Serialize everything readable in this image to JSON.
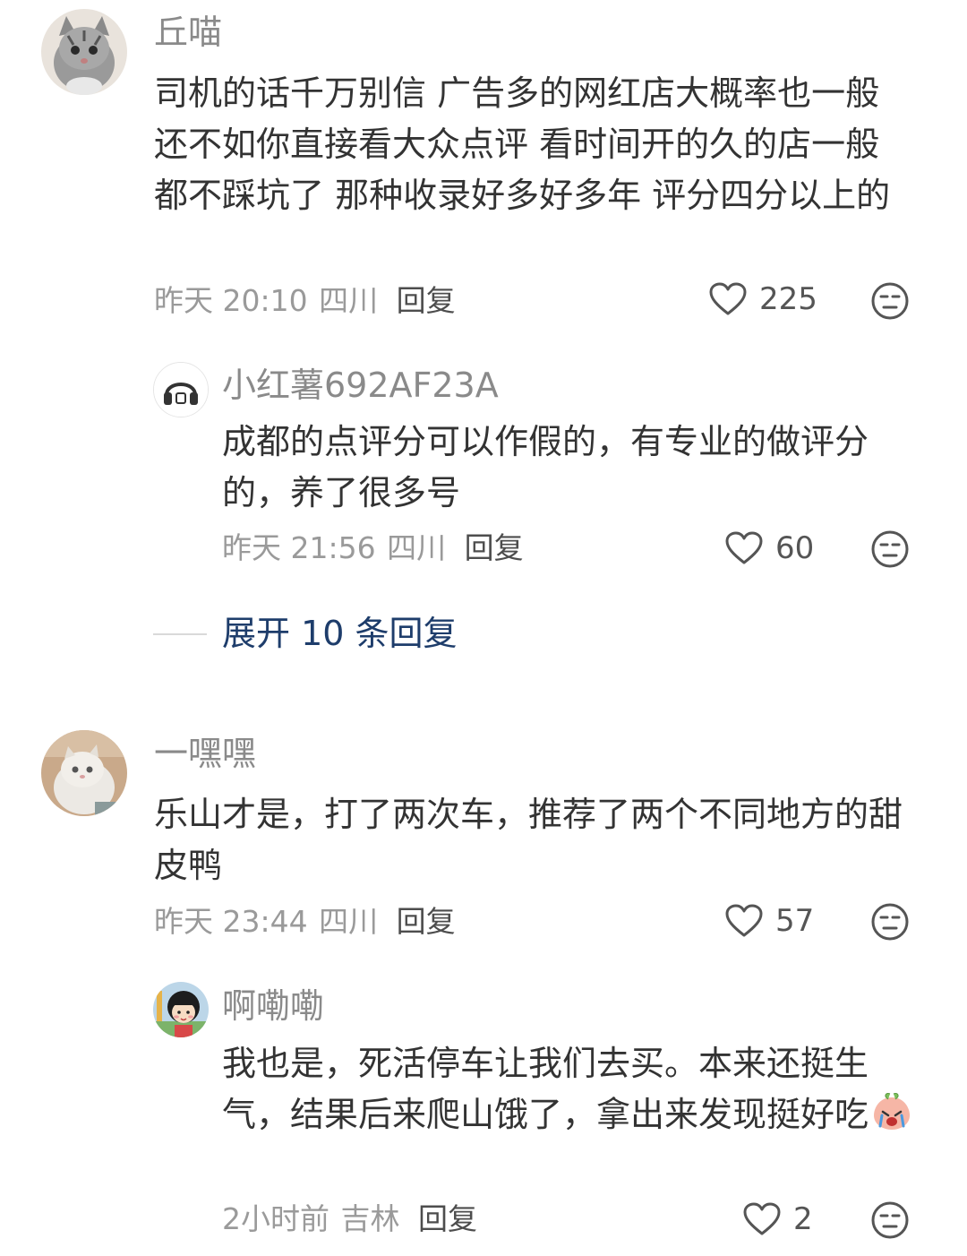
{
  "comments": [
    {
      "user": "丘喵",
      "text": "司机的话千万别信 广告多的网红店大概率也一般 还不如你直接看大众点评 看时间开的久的店一般都不踩坑了 那种收录好多好多年 评分四分以上的",
      "time": "昨天 20:10",
      "location": "四川",
      "reply_label": "回复",
      "likes": "225",
      "avatar_icon": "gray-tabby-cat-avatar",
      "replies": [
        {
          "user": "小红薯692AF23A",
          "text": "成都的点评分可以作假的，有专业的做评分的，养了很多号",
          "time": "昨天 21:56",
          "location": "四川",
          "reply_label": "回复",
          "likes": "60",
          "avatar_icon": "headphones-avatar"
        }
      ],
      "expand_label": "展开 10 条回复"
    },
    {
      "user": "一嘿嘿",
      "text": "乐山才是，打了两次车，推荐了两个不同地方的甜皮鸭",
      "time": "昨天 23:44",
      "location": "四川",
      "reply_label": "回复",
      "likes": "57",
      "avatar_icon": "white-persian-cat-avatar",
      "replies": [
        {
          "user": "啊嘞嘞",
          "text": "我也是，死活停车让我们去买。本来还挺生气，结果后来爬山饿了，拿出来发现挺好吃",
          "emoji": "crying-peach-emoji",
          "time": "2小时前",
          "location": "吉林",
          "reply_label": "回复",
          "likes": "2",
          "avatar_icon": "cartoon-girl-avatar"
        }
      ]
    }
  ],
  "colors": {
    "username": "#8a8a8a",
    "text": "#333333",
    "meta": "#9a9a9a",
    "expand": "#1e3d6b"
  }
}
